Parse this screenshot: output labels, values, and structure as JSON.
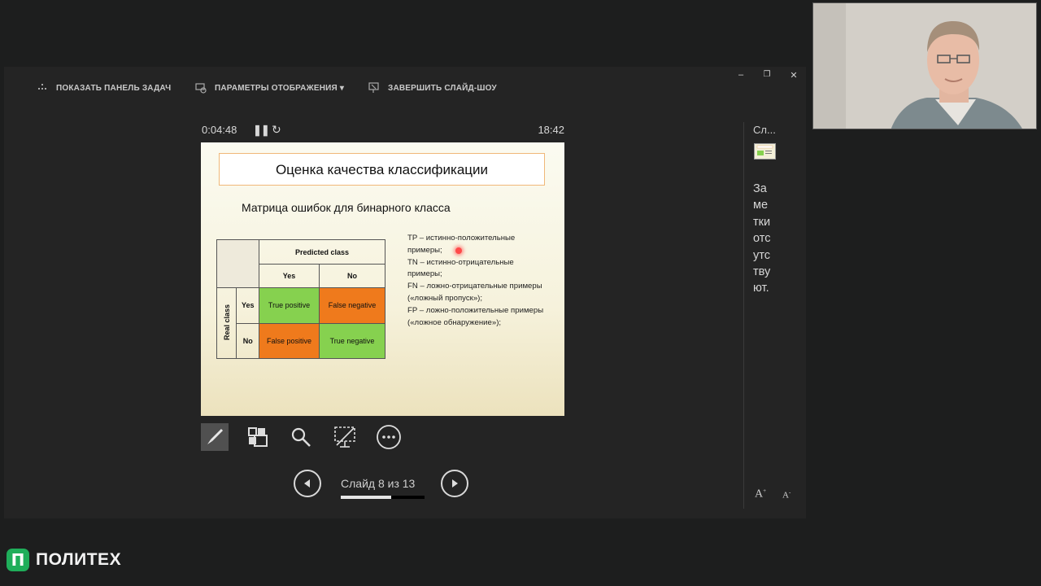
{
  "toolbar": {
    "show_taskbar": "ПОКАЗАТЬ ПАНЕЛЬ ЗАДАЧ",
    "display_settings": "ПАРАМЕТРЫ ОТОБРАЖЕНИЯ ▾",
    "end_show": "ЗАВЕРШИТЬ СЛАЙД-ШОУ"
  },
  "timer": {
    "elapsed": "0:04:48",
    "clock": "18:42"
  },
  "slide": {
    "title": "Оценка качества классификации",
    "subtitle": "Матрица ошибок для бинарного класса",
    "matrix": {
      "predicted_header": "Predicted class",
      "real_header": "Real class",
      "yes": "Yes",
      "no": "No",
      "tp": "True positive",
      "fn": "False negative",
      "fp": "False positive",
      "tn": "True negative"
    },
    "legend": [
      "TP – истинно-положительные примеры;",
      "TN – истинно-отрицательные примеры;",
      "FN – ложно-отрицательные примеры («ложный пропуск»);",
      "FP – ложно-положительные примеры («ложное обнаружение»);"
    ]
  },
  "navigation": {
    "slide_counter": "Слайд 8 из 13",
    "progress": 0.6
  },
  "side_panel": {
    "slides_label": "Сл...",
    "notes_text": "Заметки отсутствуют."
  },
  "font_controls": {
    "increase": "A",
    "decrease": "A"
  },
  "logo": {
    "mark": "П",
    "text": "ПОЛИТЕХ"
  },
  "colors": {
    "green": "#86d14f",
    "orange": "#ef7a1c",
    "logo_green": "#1fae5a"
  }
}
